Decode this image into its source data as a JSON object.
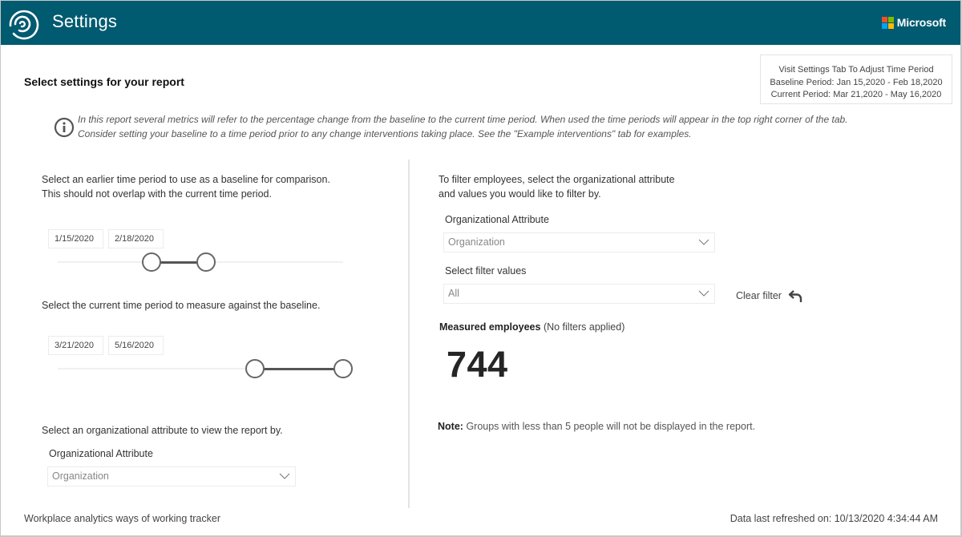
{
  "header": {
    "title": "Settings",
    "brand": "Microsoft",
    "brand_colors": [
      "#f25022",
      "#7fba00",
      "#00a4ef",
      "#ffb900"
    ],
    "bg_color": "#005a70"
  },
  "period_box": {
    "line1": "Visit Settings Tab To Adjust Time Period",
    "line2": "Baseline Period: Jan 15,2020 - Feb 18,2020",
    "line3": "Current Period: Mar 21,2020 - May 16,2020"
  },
  "section_title": "Select settings for your report",
  "info": {
    "icon": "info-icon",
    "line1": "In this report several metrics will refer to the percentage change from the baseline to the current time period.  When used the time periods will appear in the top right corner of the tab.",
    "line2": "Consider setting your baseline to a time period prior to any change interventions taking place. See the \"Example interventions\" tab for examples."
  },
  "left": {
    "baseline": {
      "instruction_line1": "Select an earlier time period to use as a baseline for comparison.",
      "instruction_line2": "This should not overlap with the current time period.",
      "start_date": "1/15/2020",
      "end_date": "2/18/2020",
      "range_start_fraction": 0.33,
      "range_end_fraction": 0.52
    },
    "current": {
      "instruction": "Select the current time period to measure against the baseline.",
      "start_date": "3/21/2020",
      "end_date": "5/16/2020",
      "range_start_fraction": 0.69,
      "range_end_fraction": 1.0
    },
    "org_attribute": {
      "instruction": "Select an organizational attribute to view the report by.",
      "label": "Organizational Attribute",
      "value": "Organization"
    }
  },
  "right": {
    "filter_instruction_line1": "To filter employees, select the organizational attribute",
    "filter_instruction_line2": "and values you would like to filter by.",
    "org_attribute_label": "Organizational Attribute",
    "org_attribute_value": "Organization",
    "filter_values_label": "Select filter values",
    "filter_values_value": "All",
    "clear_filter_label": "Clear filter",
    "measured_label": "Measured employees",
    "measured_suffix": "(No filters applied)",
    "measured_count": "744",
    "note_label": "Note:",
    "note_text": "Groups with less than 5 people will not be displayed in the report."
  },
  "footer": {
    "left": "Workplace analytics ways of working tracker",
    "right": "Data last refreshed on: 10/13/2020 4:34:44 AM"
  }
}
